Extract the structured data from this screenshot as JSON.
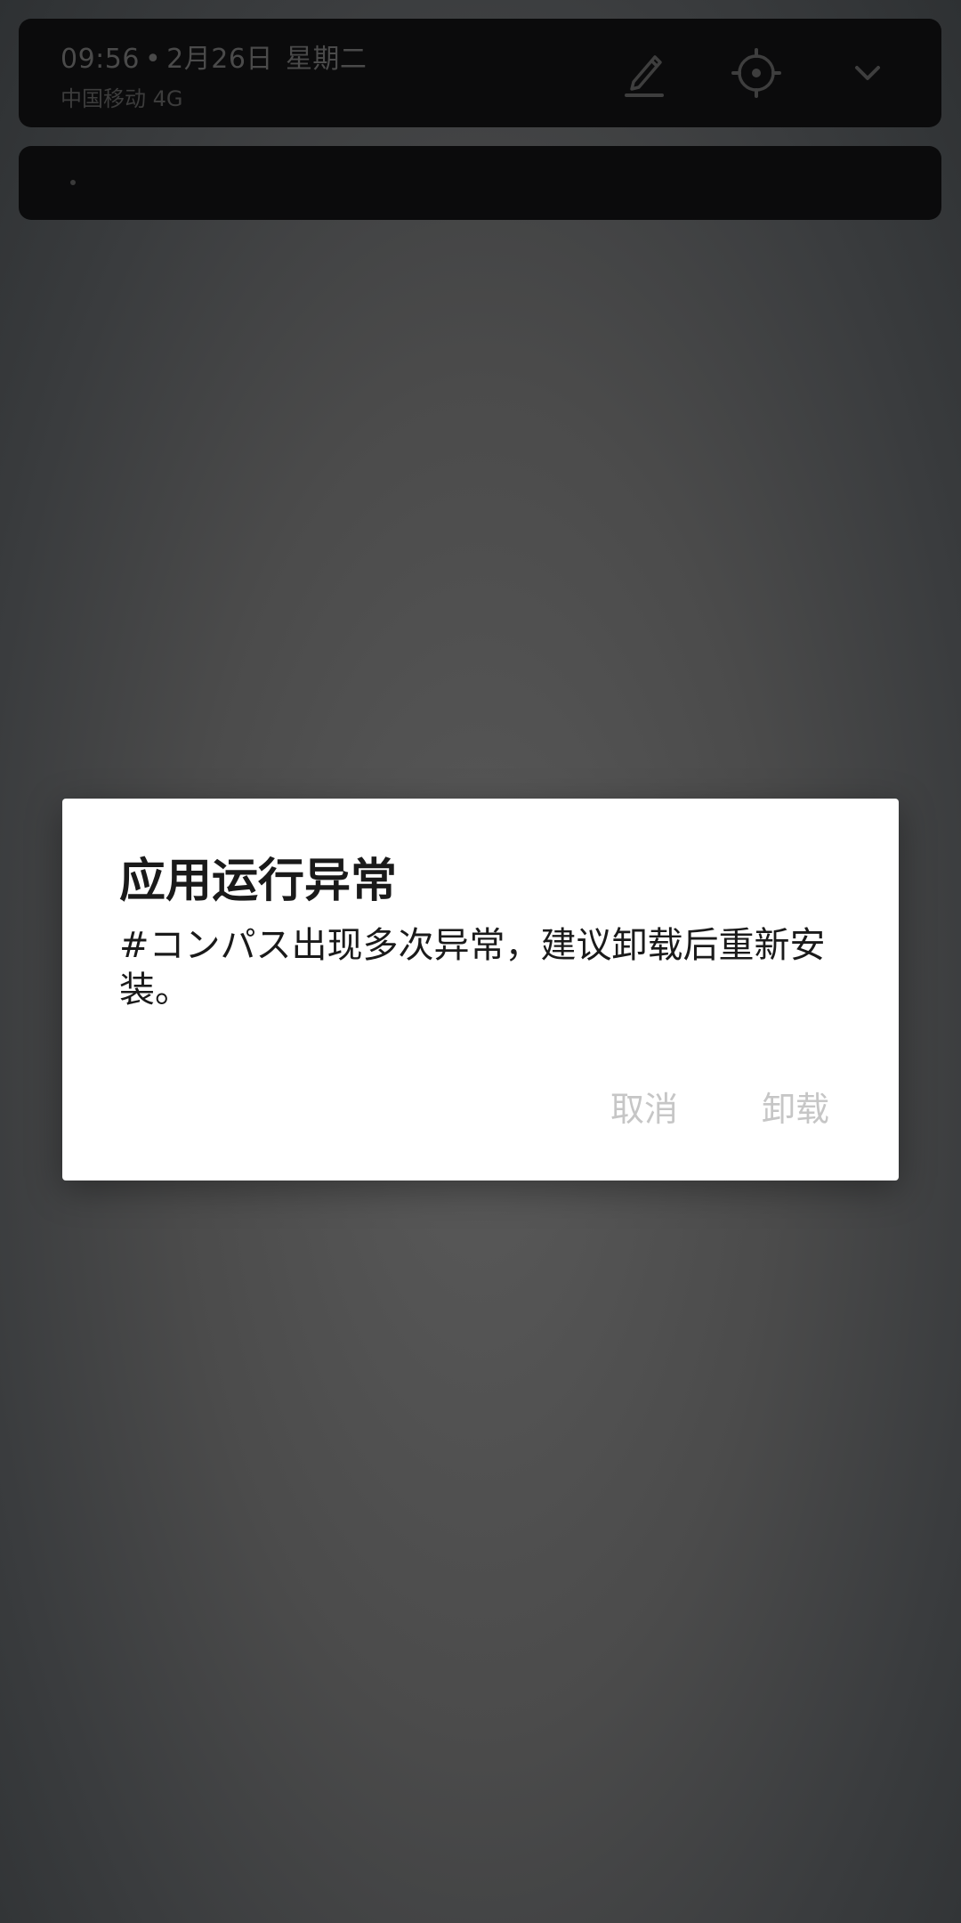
{
  "status": {
    "time": "09:56",
    "separator": "•",
    "date": "2月26日",
    "weekday": "星期二",
    "carrier": "中国移动 4G"
  },
  "header_icons": {
    "edit": "pencil-icon",
    "settings": "gear-icon",
    "expand": "chevron-down-icon"
  },
  "dialog": {
    "title": "应用运行异常",
    "message": "#コンパス出现多次异常，建议卸载后重新安装。",
    "cancel_label": "取消",
    "uninstall_label": "卸载"
  },
  "colors": {
    "dialog_bg": "#ffffff",
    "button_text": "#c6c6c6",
    "shade_bg": "#0b0b0c"
  }
}
